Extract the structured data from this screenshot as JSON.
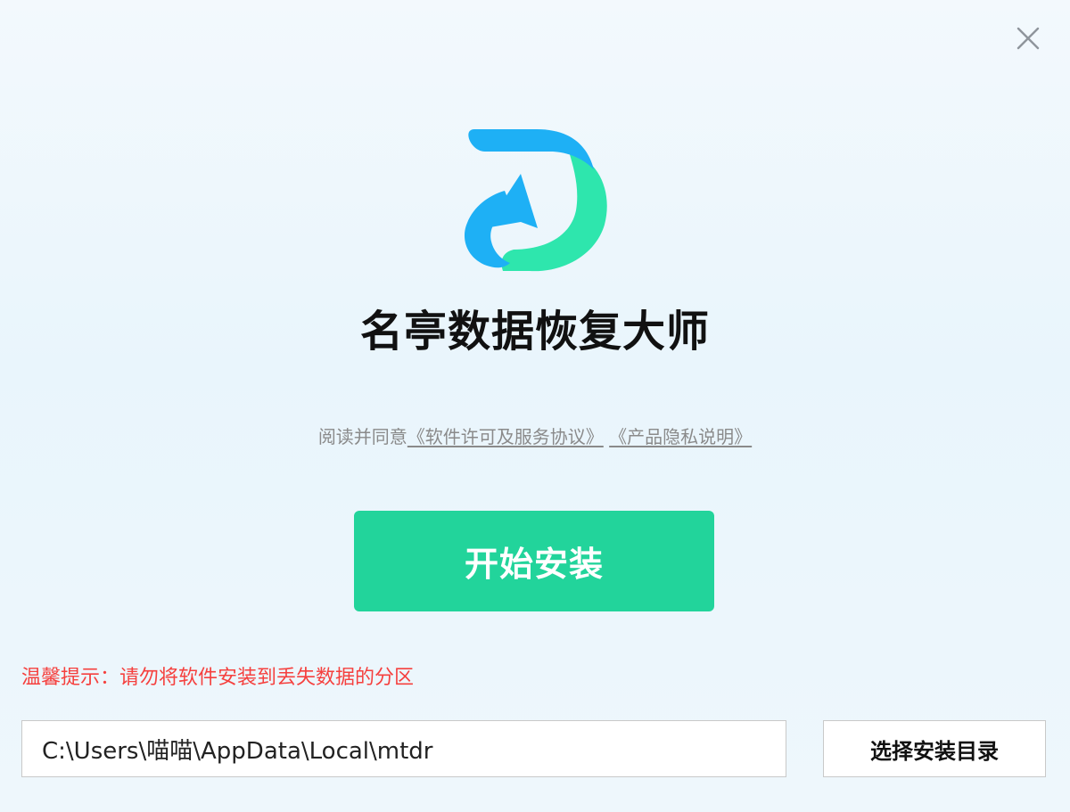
{
  "window": {
    "close_icon": "close-icon",
    "background_color": "#eef7fc"
  },
  "logo": {
    "icon": "recovery-d-arrow-logo",
    "colors": {
      "blue": "#1eb0f5",
      "green": "#2ee6ad"
    }
  },
  "app_title": "名亭数据恢复大师",
  "agreement": {
    "prefix": "阅读并同意",
    "license_link": "《软件许可及服务协议》",
    "privacy_link": "《产品隐私说明》"
  },
  "install": {
    "button_label": "开始安装",
    "button_color": "#22d49b"
  },
  "warning": {
    "text": "温馨提示：请勿将软件安装到丢失数据的分区",
    "color": "#f5403e"
  },
  "install_path": {
    "value": "C:\\Users\\喵喵\\AppData\\Local\\mtdr"
  },
  "browse_button_label": "选择安装目录"
}
